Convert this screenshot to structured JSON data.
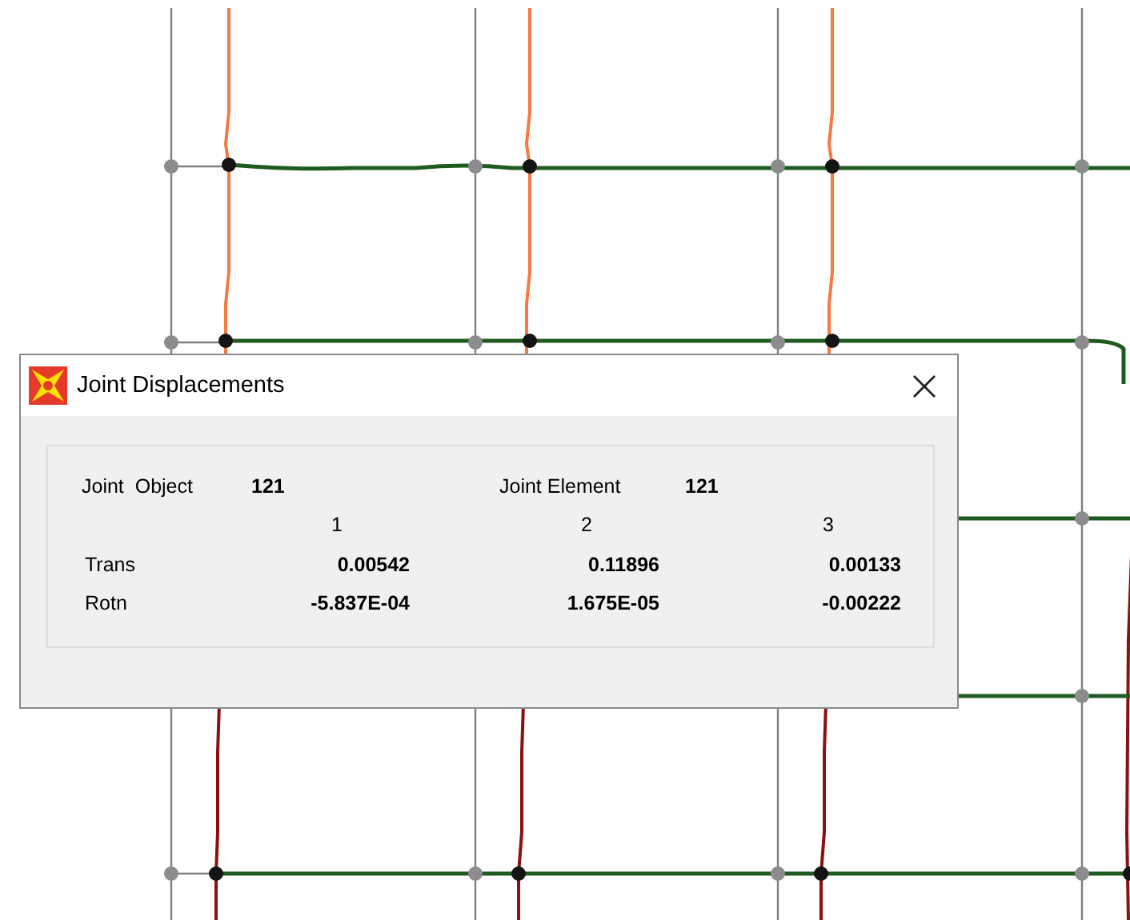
{
  "dialog": {
    "title": "Joint Displacements",
    "joint_object": {
      "label": "Joint  Object",
      "value": "121"
    },
    "joint_element": {
      "label": "Joint Element",
      "value": "121"
    },
    "columns": [
      "1",
      "2",
      "3"
    ],
    "rows": [
      {
        "label": "Trans",
        "values": [
          "0.00542",
          "0.11896",
          "0.00133"
        ]
      },
      {
        "label": "Rotn",
        "values": [
          "-5.837E-04",
          "1.675E-05",
          "-0.00222"
        ]
      }
    ]
  }
}
